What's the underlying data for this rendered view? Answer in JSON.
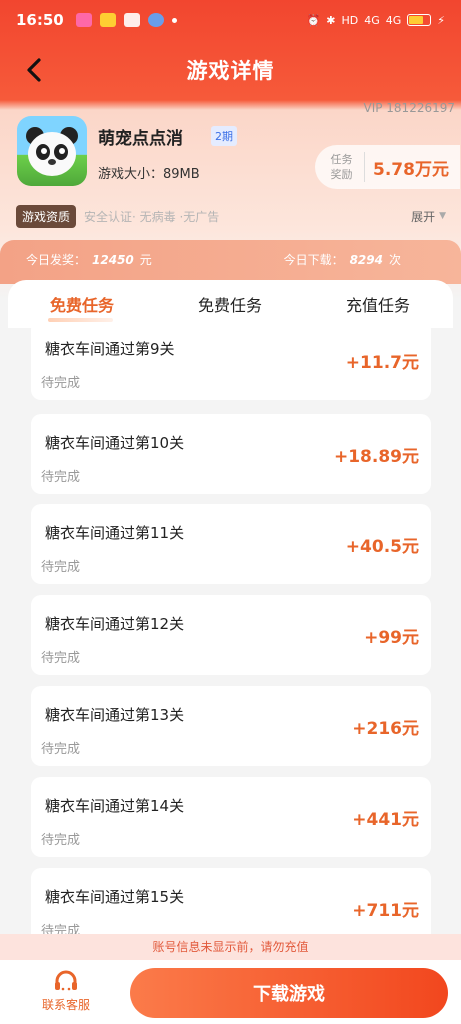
{
  "status_bar": {
    "time": "16:50",
    "network": "HD",
    "signal_a": "4G",
    "signal_b": "4G"
  },
  "header": {
    "back_label": "<",
    "title": "游戏详情"
  },
  "vip": "VIP 181226197",
  "game": {
    "name": "萌宠点点消",
    "period": "2期",
    "size": "游戏大小：89MB",
    "reward_label_1": "任务",
    "reward_label_2": "奖励",
    "reward_value": "5.78万元"
  },
  "qualification": {
    "badge": "游戏资质",
    "text": "安全认证· 无病毒 ·无广告",
    "expand": "展开"
  },
  "stats": {
    "today_award_label": "今日发奖：",
    "today_award_value": "12450",
    "today_award_unit": "元",
    "today_download_label": "今日下载：",
    "today_download_value": "8294",
    "today_download_unit": "次"
  },
  "tabs": [
    "免费任务",
    "免费任务",
    "充值任务"
  ],
  "tasks": [
    {
      "name": "糖衣车间通过第9关",
      "status": "待完成",
      "reward": "+11.7元"
    },
    {
      "name": "糖衣车间通过第10关",
      "status": "待完成",
      "reward": "+18.89元"
    },
    {
      "name": "糖衣车间通过第11关",
      "status": "待完成",
      "reward": "+40.5元"
    },
    {
      "name": "糖衣车间通过第12关",
      "status": "待完成",
      "reward": "+99元"
    },
    {
      "name": "糖衣车间通过第13关",
      "status": "待完成",
      "reward": "+216元"
    },
    {
      "name": "糖衣车间通过第14关",
      "status": "待完成",
      "reward": "+441元"
    },
    {
      "name": "糖衣车间通过第15关",
      "status": "待完成",
      "reward": "+711元"
    }
  ],
  "notice": "账号信息未显示前，请勿充值",
  "bottom": {
    "service_label": "联系客服",
    "download_label": "下载游戏"
  },
  "colors": {
    "brand_red": "#f2462f",
    "accent_orange": "#e8652a"
  }
}
